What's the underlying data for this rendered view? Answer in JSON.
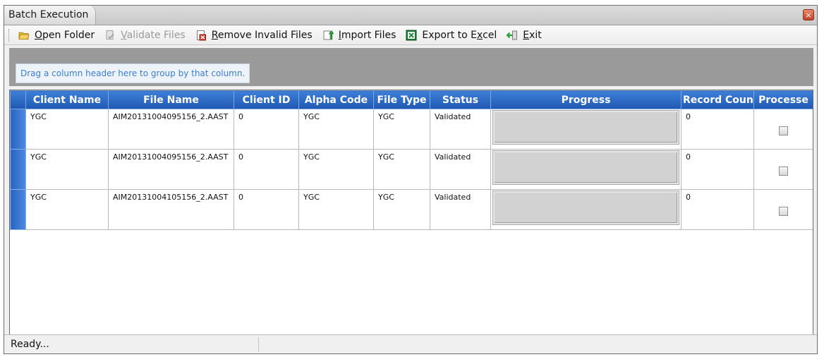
{
  "window": {
    "title": "Batch Execution",
    "close_glyph": "×"
  },
  "toolbar": {
    "open_folder": {
      "mnemonic": "O",
      "rest": "pen Folder",
      "icon": "folder-icon"
    },
    "validate_files": {
      "mnemonic": "V",
      "rest": "alidate Files",
      "icon": "validate-icon",
      "disabled": true
    },
    "remove_invalid_files": {
      "mnemonic": "R",
      "rest": "emove Invalid Files",
      "icon": "remove-icon"
    },
    "import_files": {
      "mnemonic": "I",
      "rest": "mport Files",
      "icon": "import-icon"
    },
    "export_to_excel": {
      "before": "Export to E",
      "mnemonic": "x",
      "after": "cel",
      "icon": "excel-icon"
    },
    "exit": {
      "mnemonic": "E",
      "rest": "xit",
      "icon": "exit-icon"
    }
  },
  "group_panel": {
    "hint": "Drag a column header here to group by that column."
  },
  "grid": {
    "columns": [
      "Client Name",
      "File Name",
      "Client ID",
      "Alpha Code",
      "File Type",
      "Status",
      "Progress",
      "Record Coun",
      "Processe"
    ],
    "rows": [
      {
        "client_name": "YGC",
        "file_name": "AIM20131004095156_2.AAST",
        "client_id": "0",
        "alpha_code": "YGC",
        "file_type": "YGC",
        "status": "Validated",
        "progress": 0,
        "record_count": "0",
        "processed": false
      },
      {
        "client_name": "YGC",
        "file_name": "AIM20131004095156_2.AAST",
        "client_id": "0",
        "alpha_code": "YGC",
        "file_type": "YGC",
        "status": "Validated",
        "progress": 0,
        "record_count": "0",
        "processed": false
      },
      {
        "client_name": "YGC",
        "file_name": "AIM20131004105156_2.AAST",
        "client_id": "0",
        "alpha_code": "YGC",
        "file_type": "YGC",
        "status": "Validated",
        "progress": 0,
        "record_count": "0",
        "processed": false
      }
    ]
  },
  "statusbar": {
    "text": "Ready..."
  },
  "colors": {
    "header_blue": "#2a63c2",
    "hint_text": "#3a7fd6",
    "progress_fill": "#3cb043"
  }
}
